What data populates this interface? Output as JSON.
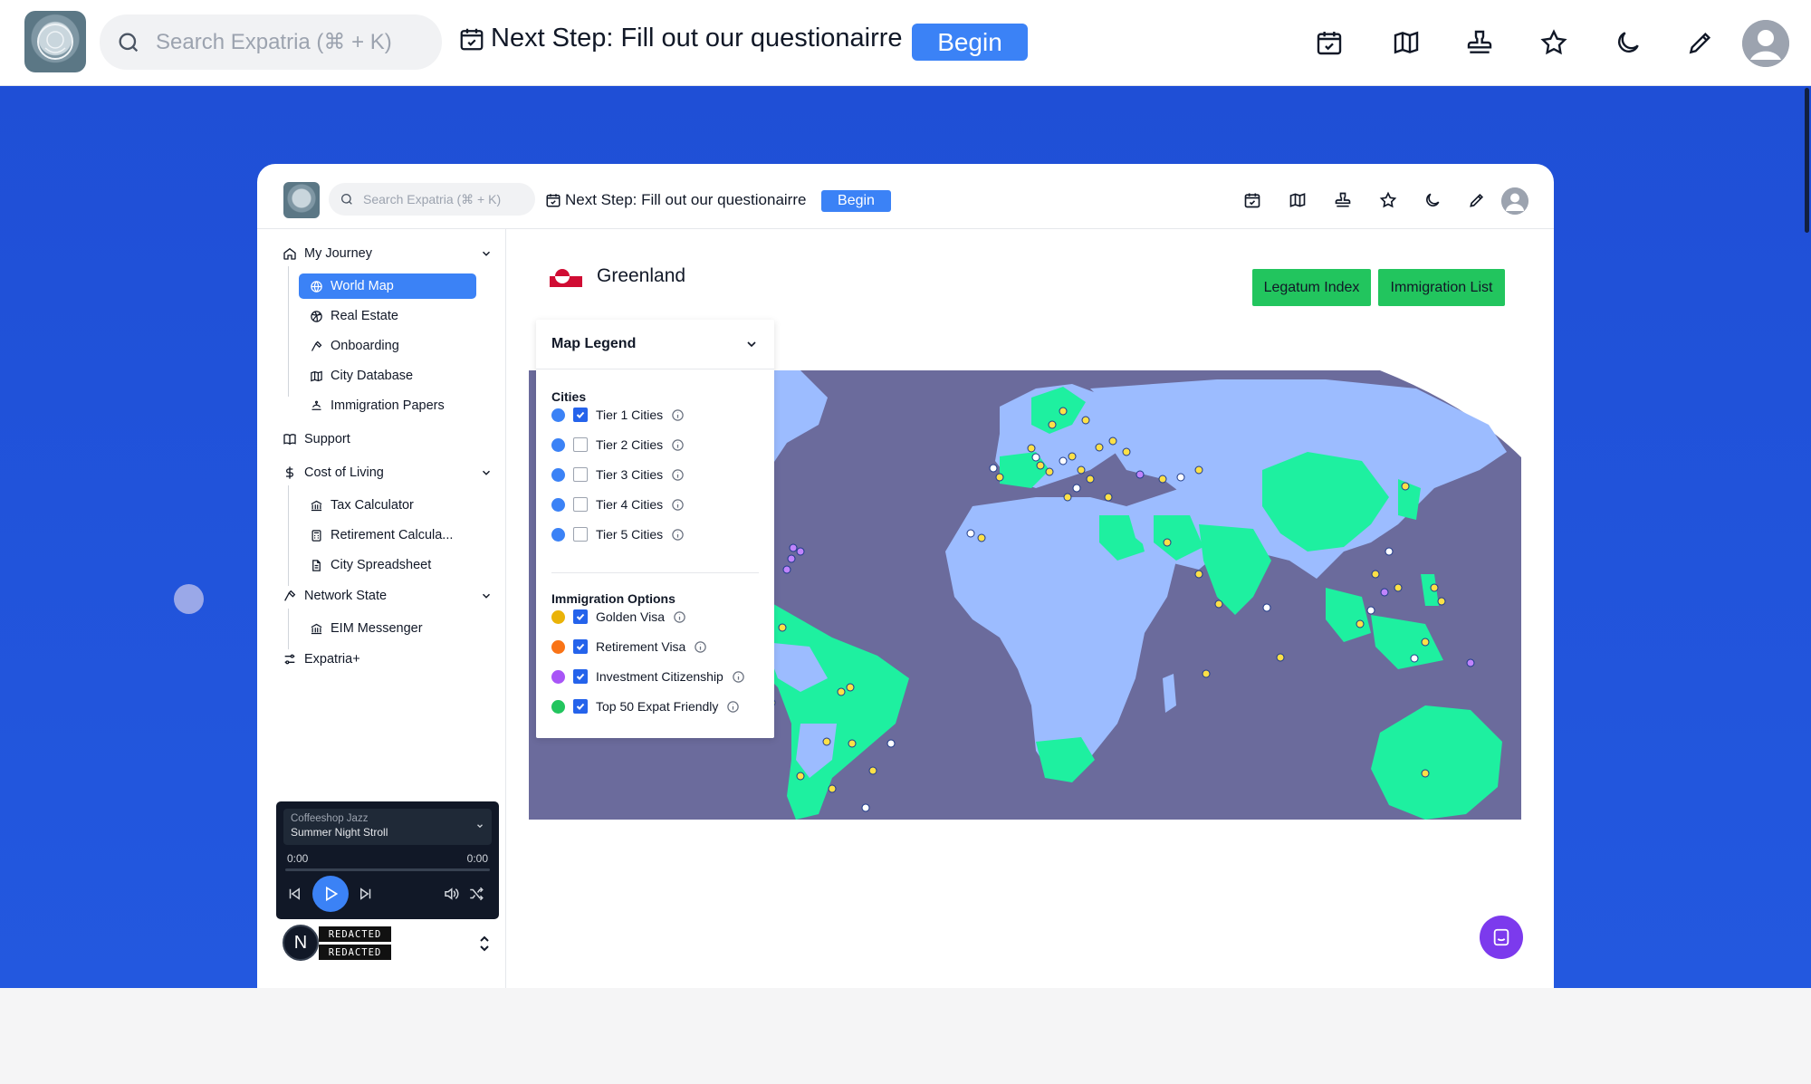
{
  "topbar": {
    "search_placeholder": "Search Expatria (⌘ + K)",
    "next_step": "Next Step: Fill out our questionairre",
    "begin_label": "Begin",
    "icons": [
      "calendar-check-icon",
      "map-icon",
      "stamp-icon",
      "star-icon",
      "moon-icon",
      "pencil-icon",
      "user-avatar-icon"
    ]
  },
  "frame": {
    "topbar": {
      "search_placeholder": "Search Expatria (⌘ + K)",
      "next_step": "Next Step: Fill out our questionairre",
      "begin_label": "Begin"
    },
    "sidebar": {
      "my_journey": "My Journey",
      "journey_items": [
        "World Map",
        "Real Estate",
        "Onboarding",
        "City Database",
        "Immigration Papers"
      ],
      "support": "Support",
      "cost_of_living": "Cost of Living",
      "col_items": [
        "Tax Calculator",
        "Retirement Calcula...",
        "City Spreadsheet"
      ],
      "network_state": "Network State",
      "ns_items": [
        "EIM Messenger"
      ],
      "expatria_plus": "Expatria+"
    },
    "player": {
      "playlist": "Coffeeshop Jazz",
      "track": "Summer Night Stroll",
      "time_current": "0:00",
      "time_total": "0:00",
      "progress": 0
    },
    "user": {
      "initial": "N",
      "name_redacted": "REDACTED",
      "email_redacted": "REDACTED"
    },
    "main": {
      "country": "Greenland",
      "legatum_btn": "Legatum Index",
      "immigration_btn": "Immigration List"
    },
    "legend": {
      "title": "Map Legend",
      "cities_title": "Cities",
      "cities": [
        {
          "label": "Tier 1 Cities",
          "checked": true,
          "color": "#3b82f6"
        },
        {
          "label": "Tier 2 Cities",
          "checked": false,
          "color": "#3b82f6"
        },
        {
          "label": "Tier 3 Cities",
          "checked": false,
          "color": "#3b82f6"
        },
        {
          "label": "Tier 4 Cities",
          "checked": false,
          "color": "#3b82f6"
        },
        {
          "label": "Tier 5 Cities",
          "checked": false,
          "color": "#3b82f6"
        }
      ],
      "immigration_title": "Immigration Options",
      "options": [
        {
          "label": "Golden Visa",
          "checked": true,
          "color": "#eab308"
        },
        {
          "label": "Retirement Visa",
          "checked": true,
          "color": "#f97316"
        },
        {
          "label": "Investment Citizenship",
          "checked": true,
          "color": "#a855f7"
        },
        {
          "label": "Top 50 Expat Friendly",
          "checked": true,
          "color": "#22c55e"
        }
      ]
    }
  },
  "colors": {
    "brand_blue": "#3b82f6",
    "hero_blue": "#1f4fd6",
    "ocean": "#6b6b9c",
    "land": "#9cbcff",
    "highlight_land": "#1ef0a0"
  }
}
